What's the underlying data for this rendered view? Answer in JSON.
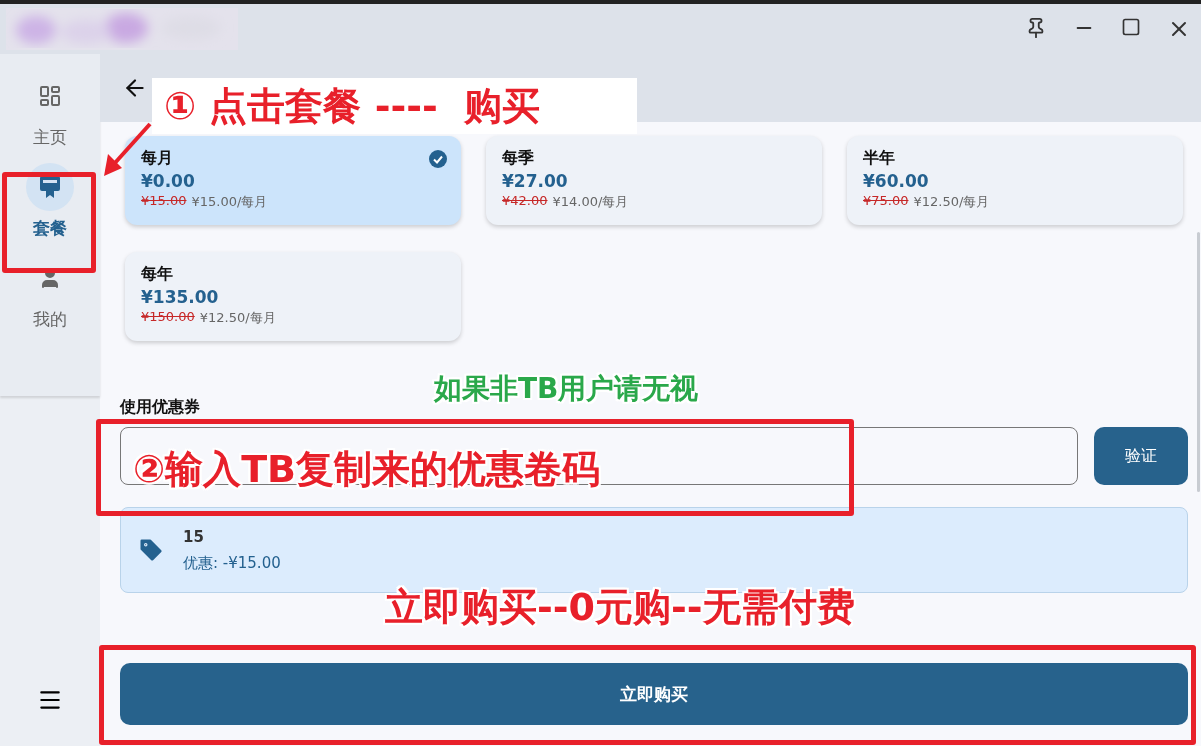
{
  "sidebar": {
    "items": [
      {
        "label": "主页",
        "kind": "dashboard",
        "selected": false
      },
      {
        "label": "套餐",
        "kind": "plan",
        "selected": true
      },
      {
        "label": "我的",
        "kind": "person",
        "selected": false
      }
    ]
  },
  "plans": [
    {
      "name": "每月",
      "price": "¥0.00",
      "original": "¥15.00",
      "per_month": "¥15.00/每月",
      "selected": true
    },
    {
      "name": "每季",
      "price": "¥27.00",
      "original": "¥42.00",
      "per_month": "¥14.00/每月",
      "selected": false
    },
    {
      "name": "半年",
      "price": "¥60.00",
      "original": "¥75.00",
      "per_month": "¥12.50/每月",
      "selected": false
    },
    {
      "name": "每年",
      "price": "¥135.00",
      "original": "¥150.00",
      "per_month": "¥12.50/每月",
      "selected": false
    }
  ],
  "coupon": {
    "label": "使用优惠券",
    "verify": "验证",
    "code": "15",
    "discount": "优惠: -¥15.00"
  },
  "buy_button": "立即购买",
  "annotations": {
    "step1": "① 点击套餐 ----  购买",
    "hint": "如果非TB用户请无视",
    "step2": "②输入TB复制来的优惠卷码",
    "step3": "立即购买--0元购--无需付费"
  }
}
